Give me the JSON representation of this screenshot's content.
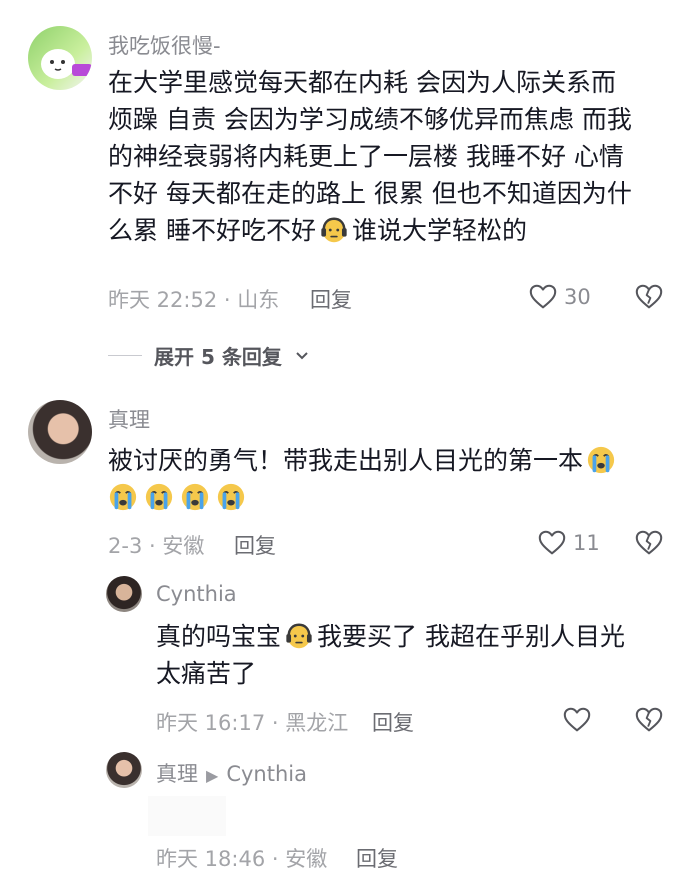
{
  "comment1": {
    "username": "我吃饭很慢-",
    "text_lines": [
      "在大学里感觉每天都在内耗 会因为人际关系而",
      "烦躁 自责 会因为学习成绩不够优异而焦虑 而我",
      "的神经衰弱将内耗更上了一层楼 我睡不好 心情",
      "不好 每天都在走的路上 很累 但也不知道因为什",
      "么累 睡不好吃不好",
      "谁说大学轻松的"
    ],
    "time_location": "昨天 22:52 · 山东",
    "reply_label": "回复",
    "like_count": "30",
    "icons": [
      "avatar",
      "headphone-emoji",
      "heart-icon",
      "dislike-heart-icon"
    ]
  },
  "expand": {
    "label": "展开 5 条回复"
  },
  "comment2": {
    "username": "真理",
    "text_lines": [
      "被讨厌的勇气！带我走出别人目光的第一本"
    ],
    "time_location": "2-3 · 安徽",
    "reply_label": "回复",
    "like_count": "11"
  },
  "reply1": {
    "username": "Cynthia",
    "text_part1": "真的吗宝宝",
    "text_part2": "我要买了 我超在乎别人目光",
    "text_line2": "太痛苦了",
    "time_location": "昨天 16:17 · 黑龙江",
    "reply_label": "回复"
  },
  "reply2": {
    "username": "真理",
    "reply_to": "Cynthia",
    "time_location": "昨天 18:46 · 安徽",
    "reply_label": "回复"
  },
  "colors": {
    "text": "#161823",
    "muted": "#8a8b91",
    "emoji": "#f5c84b",
    "cry_tear": "#4aa3ea"
  }
}
